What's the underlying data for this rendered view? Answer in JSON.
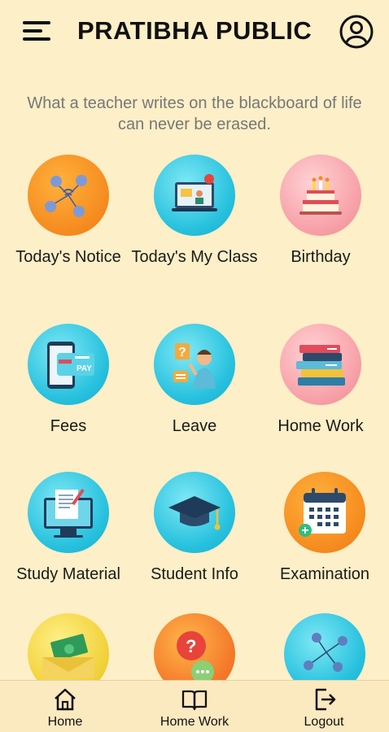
{
  "header": {
    "title": "PRATIBHA PUBLIC",
    "menu_icon": "hamburger-menu-icon",
    "profile_icon": "user-profile-icon"
  },
  "tagline": "What a teacher writes on the blackboard of life can never be erased.",
  "tiles": [
    {
      "label": "Today's Notice",
      "icon": "network-notice-icon",
      "color": "#f58a1f"
    },
    {
      "label": "Today's My Class",
      "icon": "online-class-icon",
      "color": "#27c1de"
    },
    {
      "label": "Birthday",
      "icon": "birthday-cake-icon",
      "color": "#f7a1a8"
    },
    {
      "label": "Fees",
      "icon": "phone-pay-icon",
      "color": "#27c1de"
    },
    {
      "label": "Leave",
      "icon": "leave-request-icon",
      "color": "#27c1de"
    },
    {
      "label": "Home Work",
      "icon": "books-stack-icon",
      "color": "#f7a1a8"
    },
    {
      "label": "Study Material",
      "icon": "computer-document-icon",
      "color": "#27c1de"
    },
    {
      "label": "Student Info",
      "icon": "graduation-cap-icon",
      "color": "#27c1de"
    },
    {
      "label": "Examination",
      "icon": "calendar-icon",
      "color": "#f58a1f"
    },
    {
      "label": "",
      "icon": "money-envelope-icon",
      "color": "#f2d23b"
    },
    {
      "label": "",
      "icon": "question-chat-icon",
      "color": "#f47a2a"
    },
    {
      "label": "",
      "icon": "network-people-icon",
      "color": "#27c1de"
    }
  ],
  "bottom_nav": {
    "home": "Home",
    "home_work": "Home Work",
    "logout": "Logout"
  }
}
